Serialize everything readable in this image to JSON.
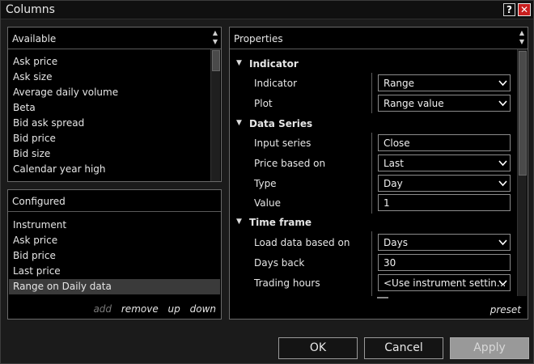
{
  "window": {
    "title": "Columns",
    "help_label": "?",
    "close_label": "✕"
  },
  "available": {
    "header": "Available",
    "items": [
      "Ask price",
      "Ask size",
      "Average daily volume",
      "Beta",
      "Bid ask spread",
      "Bid price",
      "Bid size",
      "Calendar year high"
    ]
  },
  "configured": {
    "header": "Configured",
    "items": [
      "Instrument",
      "Ask price",
      "Bid price",
      "Last price",
      "Range on Daily data"
    ],
    "selected_index": 4,
    "actions": {
      "add": "add",
      "remove": "remove",
      "up": "up",
      "down": "down"
    }
  },
  "properties": {
    "header": "Properties",
    "preset": "preset",
    "indicator": {
      "label": "Indicator",
      "indicator_label": "Indicator",
      "indicator_value": "Range",
      "plot_label": "Plot",
      "plot_value": "Range value"
    },
    "data_series": {
      "label": "Data Series",
      "input_series_label": "Input series",
      "input_series_value": "Close",
      "price_based_on_label": "Price based on",
      "price_based_on_value": "Last",
      "type_label": "Type",
      "type_value": "Day",
      "value_label": "Value",
      "value_value": "1"
    },
    "time_frame": {
      "label": "Time frame",
      "load_data_label": "Load data based on",
      "load_data_value": "Days",
      "days_back_label": "Days back",
      "days_back_value": "30",
      "trading_hours_label": "Trading hours",
      "trading_hours_value": "<Use instrument settin..."
    }
  },
  "buttons": {
    "ok": "OK",
    "cancel": "Cancel",
    "apply": "Apply"
  }
}
